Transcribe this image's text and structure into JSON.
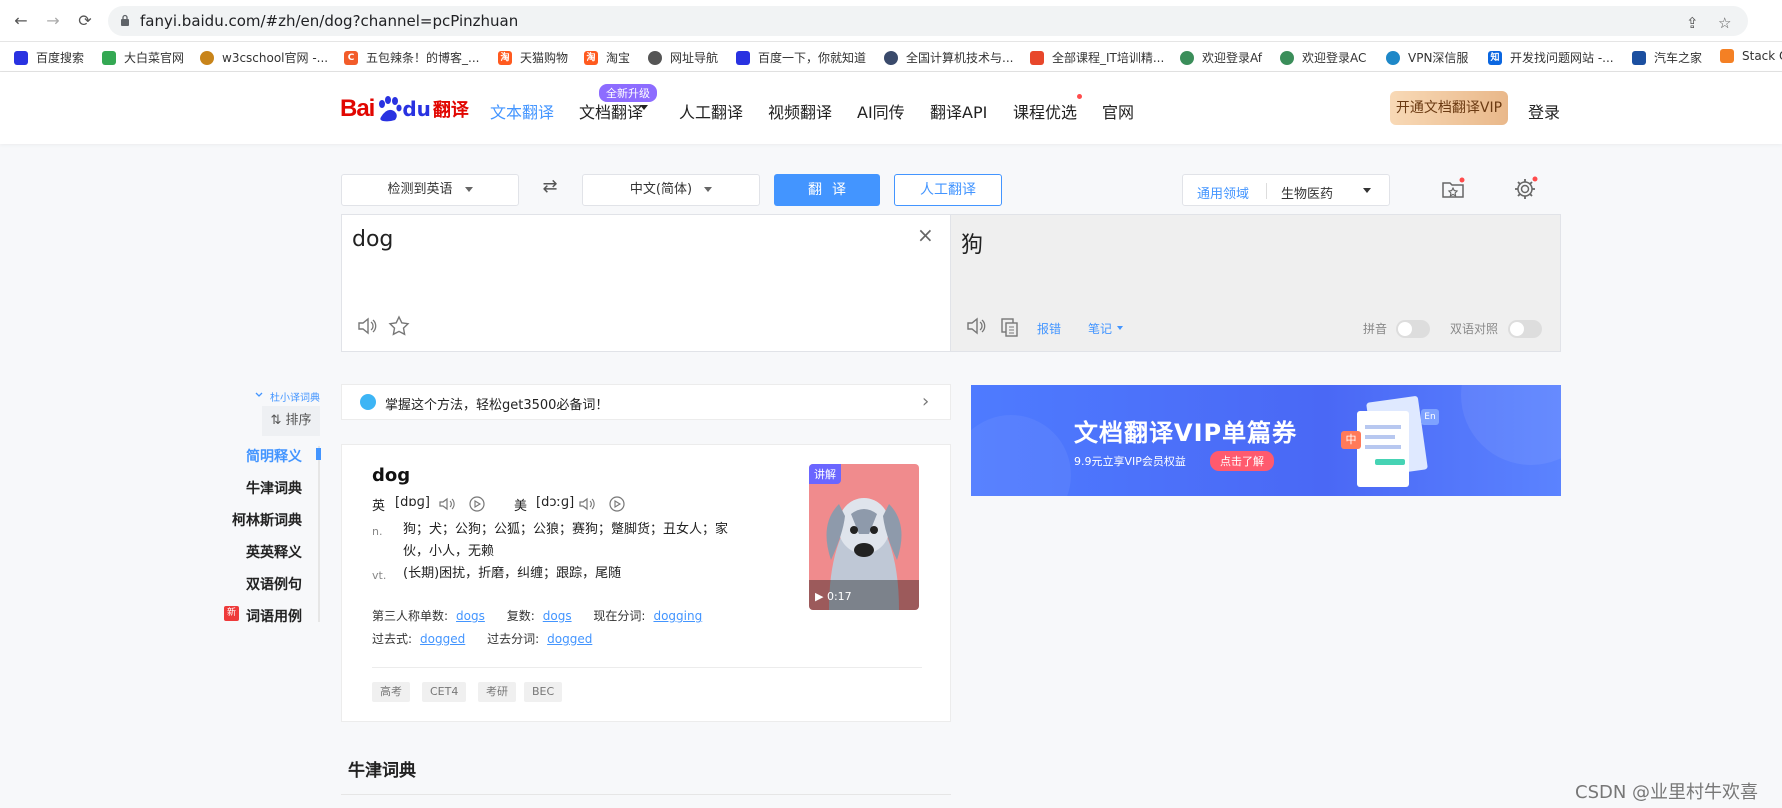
{
  "browser": {
    "url": "fanyi.baidu.com/#zh/en/dog?channel=pcPinzhuan",
    "bookmarks": [
      "百度搜索",
      "大白菜官网",
      "w3cschool官网 -...",
      "五包辣条！的博客_...",
      "天猫购物",
      "淘宝",
      "网址导航",
      "百度一下，你就知道",
      "全国计算机技术与...",
      "全部课程_IT培训精...",
      "欢迎登录Af",
      "欢迎登录AC",
      "VPN深信服",
      "开发找问题网站 -...",
      "汽车之家",
      "Stack O"
    ]
  },
  "header": {
    "logo_bai": "Bai",
    "logo_du": "du",
    "logo_fy": "翻译",
    "nav": [
      "文本翻译",
      "文档翻译",
      "人工翻译",
      "视频翻译",
      "AI同传",
      "翻译API",
      "课程优选",
      "官网"
    ],
    "new_badge": "全新升级",
    "vip_button": "开通文档翻译VIP",
    "login": "登录"
  },
  "controls": {
    "source_lang": "检测到英语",
    "target_lang": "中文(简体)",
    "translate_btn": "翻译",
    "human_btn": "人工翻译",
    "domain_label": "通用领域",
    "domain_value": "生物医药"
  },
  "source": {
    "text": "dog"
  },
  "result": {
    "text": "狗",
    "report": "报错",
    "notes": "笔记",
    "pinyin": "拼音",
    "bilingual": "双语对照"
  },
  "sidebar": {
    "dict_source": "杜小译词典",
    "sort": "排序",
    "items": [
      "简明释义",
      "牛津词典",
      "柯林斯词典",
      "英英释义",
      "双语例句",
      "词语用例"
    ],
    "new_tag": "新"
  },
  "tip": {
    "text": "掌握这个方法，轻松get3500必备词！"
  },
  "dict": {
    "word": "dog",
    "uk_label": "英",
    "uk_ph": "[dɒɡ]",
    "us_label": "美",
    "us_ph": "[dɔːɡ]",
    "n_label": "n.",
    "n_def1": "狗；犬；公狗；公狐；公狼；赛狗；蹩脚货；丑女人；家",
    "n_def2": "伙，小人，无赖",
    "vt_label": "vt.",
    "vt_def": "(长期)困扰，折磨，纠缠；跟踪，尾随",
    "f1_label": "第三人称单数:",
    "f1_val": "dogs",
    "f2_label": "复数:",
    "f2_val": "dogs",
    "f3_label": "现在分词:",
    "f3_val": "dogging",
    "f4_label": "过去式:",
    "f4_val": "dogged",
    "f5_label": "过去分词:",
    "f5_val": "dogged",
    "tags": [
      "高考",
      "CET4",
      "考研",
      "BEC"
    ],
    "video_tag": "讲解",
    "video_duration": "▶ 0:17"
  },
  "next_section": "牛津词典",
  "banner": {
    "title": "文档翻译VIP单篇券",
    "sub": "9.9元立享VIP会员权益",
    "cta": "点击了解",
    "badge_zh": "中",
    "badge_en": "En"
  },
  "watermark": "CSDN @业里村牛欢喜",
  "colors": {
    "accent": "#4395ff",
    "brand_red": "#e10601",
    "brand_blue": "#2932e1"
  }
}
